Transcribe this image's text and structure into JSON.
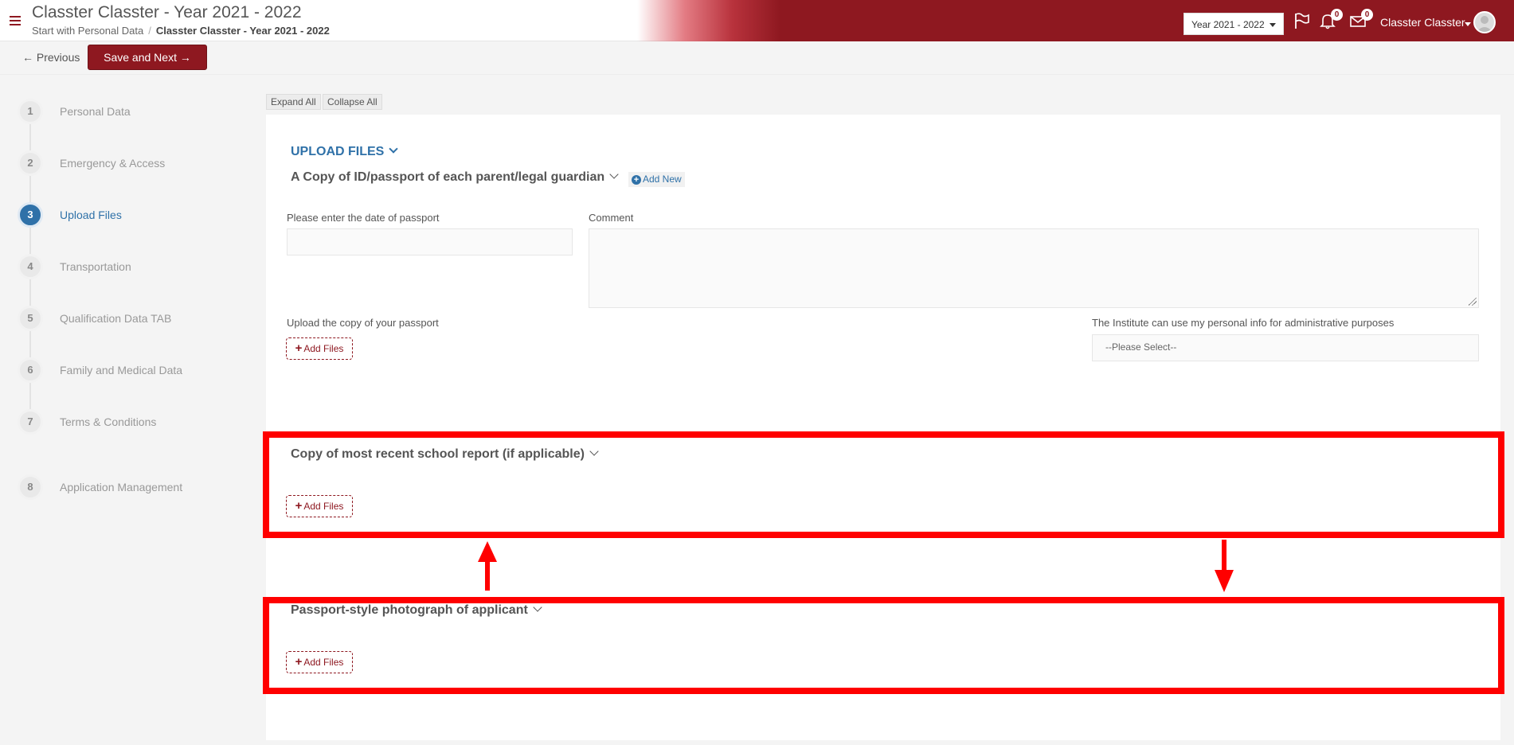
{
  "header": {
    "title": "Classter Classter - Year 2021 - 2022",
    "breadcrumb_start": "Start with Personal Data",
    "breadcrumb_current": "Classter Classter - Year 2021 - 2022",
    "year_select": "Year 2021 - 2022",
    "notifications_count": "0",
    "messages_count": "0",
    "user_name": "Classter Classter",
    "brand_color": "#8e1820"
  },
  "toolbar": {
    "previous_label": "← Previous",
    "save_next_label": "Save and Next →"
  },
  "steps": [
    {
      "number": "1",
      "label": "Personal Data"
    },
    {
      "number": "2",
      "label": "Emergency & Access"
    },
    {
      "number": "3",
      "label": "Upload Files"
    },
    {
      "number": "4",
      "label": "Transportation"
    },
    {
      "number": "5",
      "label": "Qualification Data TAB"
    },
    {
      "number": "6",
      "label": "Family and Medical Data"
    },
    {
      "number": "7",
      "label": "Terms & Conditions"
    },
    {
      "number": "8",
      "label": "Application Management"
    }
  ],
  "active_step": 3,
  "main": {
    "expand_all": "Expand All",
    "collapse_all": "Collapse All",
    "section_title": "UPLOAD FILES",
    "id_copy": {
      "title": "A Copy of ID/passport of each parent/legal guardian",
      "add_new": "Add New",
      "date_label": "Please enter the date of passport",
      "date_value": "",
      "comment_label": "Comment",
      "comment_value": "",
      "upload_label": "Upload the copy of your passport",
      "add_files": "Add Files",
      "consent_label": "The Institute can use my personal info for administrative purposes",
      "consent_select": "--Please Select--"
    },
    "school_report": {
      "title": "Copy of most recent school report (if applicable)",
      "add_files": "Add Files"
    },
    "photo": {
      "title": "Passport-style photograph of applicant",
      "add_files": "Add Files"
    }
  },
  "annotation_color": "#ff0000"
}
